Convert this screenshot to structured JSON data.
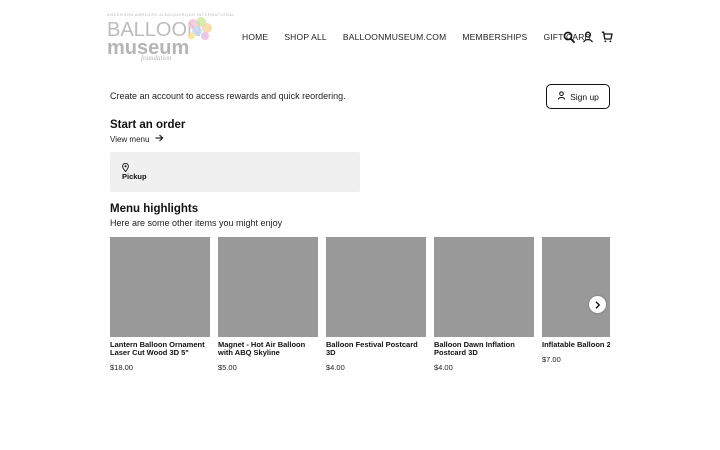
{
  "logo": {
    "top_text": "ANDERSON ABRUZZO ALBUQUERQUE INTERNATIONAL",
    "line1": "BALLOON",
    "line2": "museum",
    "line3": "foundation"
  },
  "nav": {
    "items": [
      "HOME",
      "SHOP ALL",
      "BALLOONMUSEUM.COM",
      "MEMBERSHIPS",
      "GIFT CARD"
    ]
  },
  "icons": {
    "search": "search-icon",
    "account": "user-icon",
    "cart": "cart-icon"
  },
  "account": {
    "text": "Create an account to access rewards and quick reordering.",
    "signup_label": "Sign up"
  },
  "order": {
    "title": "Start an order",
    "view_menu": "View menu",
    "pickup_label": "Pickup"
  },
  "highlights": {
    "title": "Menu highlights",
    "subtitle": "Here are some other items you might enjoy",
    "items": [
      {
        "name": "Lantern Balloon Ornament Laser Cut Wood 3D 5\"",
        "price": "$18.00"
      },
      {
        "name": "Magnet - Hot Air Balloon with ABQ Skyline",
        "price": "$5.00"
      },
      {
        "name": "Balloon Festival Postcard 3D",
        "price": "$4.00"
      },
      {
        "name": "Balloon Dawn Inflation Postcard 3D",
        "price": "$4.00"
      },
      {
        "name": "Inflatable Balloon 2",
        "price": "$7.00"
      }
    ]
  },
  "colors": {
    "placeholder_image": "#999999",
    "card_bg": "#f0f0f0",
    "logo_gray": "#b5b5b5"
  }
}
